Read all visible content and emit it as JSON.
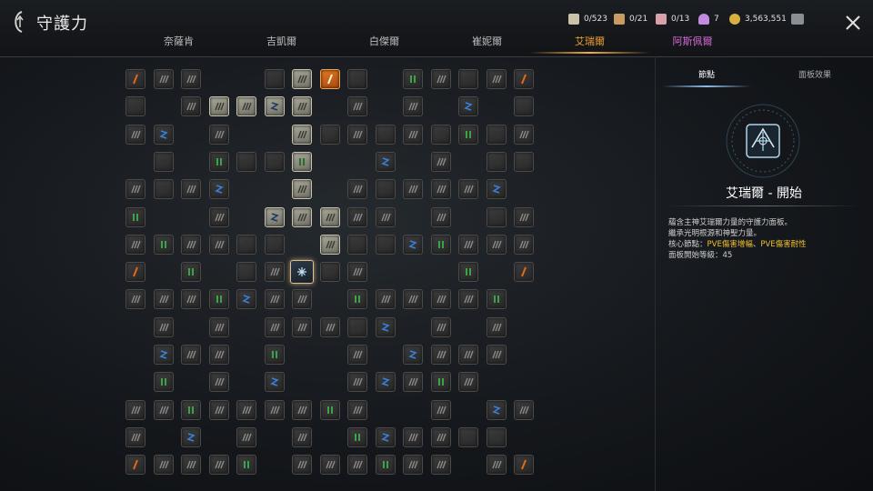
{
  "header": {
    "title": "守護力",
    "tabs": [
      {
        "label": "奈薩肯",
        "state": "normal"
      },
      {
        "label": "吉凱爾",
        "state": "normal"
      },
      {
        "label": "白傑爾",
        "state": "normal"
      },
      {
        "label": "崔妮爾",
        "state": "normal"
      },
      {
        "label": "艾瑞爾",
        "state": "active"
      },
      {
        "label": "阿斯佩爾",
        "state": "pink"
      }
    ],
    "currencies": [
      {
        "icon": "scroll-icon",
        "value": "0/523",
        "color": "#c9c2a8"
      },
      {
        "icon": "parchment-icon",
        "value": "0/21",
        "color": "#c99a62"
      },
      {
        "icon": "tome-icon",
        "value": "0/13",
        "color": "#d8a0a8"
      },
      {
        "icon": "crystal-icon",
        "value": "7",
        "color": "#c28ae0"
      },
      {
        "icon": "gold-coin-icon",
        "value": "3,563,551",
        "color": "#d8b040"
      }
    ]
  },
  "side_panel": {
    "tabs": [
      "節點",
      "面板效果"
    ],
    "active_tab": "節點",
    "node_name": "艾瑞爾 - 開始",
    "desc_line1": "蘊含主神艾瑞爾力量的守護力面板。",
    "desc_line2": "繼承光明根源和神聖力量。",
    "core_label": "核心節點：",
    "core_value_1": "PVE傷害增幅",
    "core_sep": "、",
    "core_value_2": "PVE傷害耐性",
    "start_level": "面板開始等級：45"
  },
  "board": {
    "icon_colors": {
      "gray": "#8a8a8a",
      "green": "#3fae4a",
      "blue": "#3a7fd8",
      "orange": "#e06a1a",
      "dark": "#333333"
    },
    "rows": [
      "o g g . . - a O - . g g - g o",
      "- . g a a E a . g . g . b . -",
      "g b . g . . a - g - g - g - g",
      ". - . g - - A . . b . g . - -",
      "g - g b . . a . g - g g g b .",
      "g . . g . e a a g g . g . - g",
      "g g g g - - . a - - b g g g g",
      "o . g . - g C - g . . . g . o",
      "g g g g b g g . g g g g g g .",
      ". g . g . g g g - b . g . g .",
      ". b g g . g . . g . b g g g .",
      ". g . g . b . . g b g g g . .",
      "g g g g g g g g g . . g . b g",
      "g . b . g . g . g b g g - - .",
      "o g g g g . g g g g g g . g o"
    ]
  }
}
